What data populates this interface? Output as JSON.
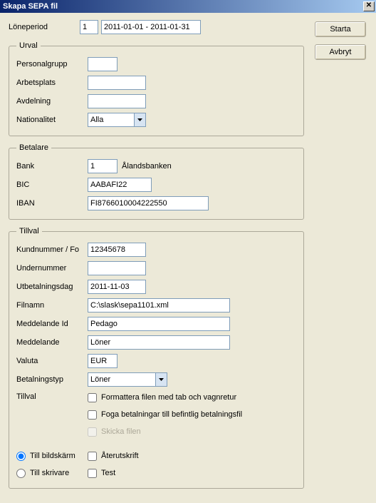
{
  "window": {
    "title": "Skapa SEPA fil",
    "close_glyph": "✕"
  },
  "buttons": {
    "start": "Starta",
    "cancel": "Avbryt"
  },
  "period": {
    "label": "Löneperiod",
    "code": "1",
    "range": "2011-01-01 - 2011-01-31"
  },
  "urval": {
    "legend": "Urval",
    "personalgrupp_label": "Personalgrupp",
    "personalgrupp_value": "",
    "arbetsplats_label": "Arbetsplats",
    "arbetsplats_value": "",
    "avdelning_label": "Avdelning",
    "avdelning_value": "",
    "nationalitet_label": "Nationalitet",
    "nationalitet_value": "Alla"
  },
  "betalare": {
    "legend": "Betalare",
    "bank_label": "Bank",
    "bank_code": "1",
    "bank_name": "Ålandsbanken",
    "bic_label": "BIC",
    "bic_value": "AABAFI22",
    "iban_label": "IBAN",
    "iban_value": "FI8766010004222550"
  },
  "tillval": {
    "legend": "Tillval",
    "kundnummer_label": "Kundnummer / Fo",
    "kundnummer_value": "12345678",
    "undernummer_label": "Undernummer",
    "undernummer_value": "",
    "utbetalningsdag_label": "Utbetalningsdag",
    "utbetalningsdag_value": "2011-11-03",
    "filnamn_label": "Filnamn",
    "filnamn_value": "C:\\slask\\sepa1101.xml",
    "meddelandeid_label": "Meddelande Id",
    "meddelandeid_value": "Pedago",
    "meddelande_label": "Meddelande",
    "meddelande_value": "Löner",
    "valuta_label": "Valuta",
    "valuta_value": "EUR",
    "betalningstyp_label": "Betalningstyp",
    "betalningstyp_value": "Löner",
    "tillval_label": "Tillval",
    "opt_tab": "Formattera filen med tab och vagnretur",
    "opt_foga": "Foga betalningar till befintlig betalningsfil",
    "opt_skicka": "Skicka filen",
    "radio_bildskarm": "Till bildskärm",
    "radio_skrivare": "Till skrivare",
    "opt_aterutskrift": "Återutskrift",
    "opt_test": "Test"
  }
}
